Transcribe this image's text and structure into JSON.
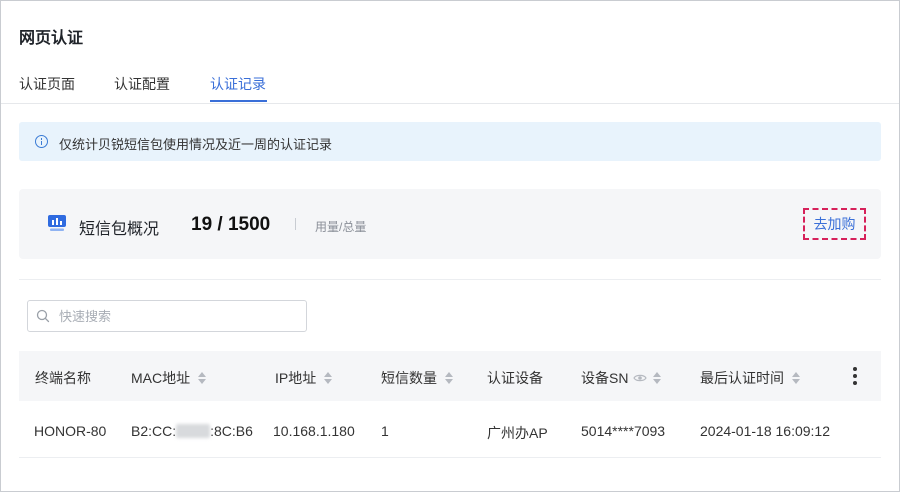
{
  "page": {
    "title": "网页认证"
  },
  "tabs": [
    {
      "label": "认证页面",
      "active": false
    },
    {
      "label": "认证配置",
      "active": false
    },
    {
      "label": "认证记录",
      "active": true
    }
  ],
  "notice": {
    "icon": "info-icon",
    "text": "仅统计贝锐短信包使用情况及近一周的认证记录"
  },
  "summary": {
    "icon": "sms-package-icon",
    "label": "短信包概况",
    "used": "19",
    "total": "1500",
    "count_text": "19 / 1500",
    "unit_text": "用量/总量",
    "buy_label": "去加购"
  },
  "search": {
    "placeholder": "快速搜索",
    "value": ""
  },
  "table": {
    "columns": [
      {
        "label": "终端名称",
        "sortable": false
      },
      {
        "label": "MAC地址",
        "sortable": true
      },
      {
        "label": "IP地址",
        "sortable": true
      },
      {
        "label": "短信数量",
        "sortable": true
      },
      {
        "label": "认证设备",
        "sortable": false
      },
      {
        "label": "设备SN",
        "sortable": true,
        "icon": "eye-icon"
      },
      {
        "label": "最后认证时间",
        "sortable": true
      }
    ],
    "more_icon": "more-vertical-icon",
    "rows": [
      {
        "terminal": "HONOR-80",
        "mac_prefix": "B2:CC:",
        "mac_suffix": ":8C:B6",
        "ip": "10.168.1.180",
        "sms": "1",
        "device": "广州办AP",
        "sn": "5014****7093",
        "last_time": "2024-01-18 16:09:12"
      }
    ]
  },
  "colors": {
    "accent": "#3a6fd8",
    "highlight_border": "#d6215a",
    "notice_bg": "#e8f3fc",
    "panel_bg": "#f5f6f8"
  }
}
